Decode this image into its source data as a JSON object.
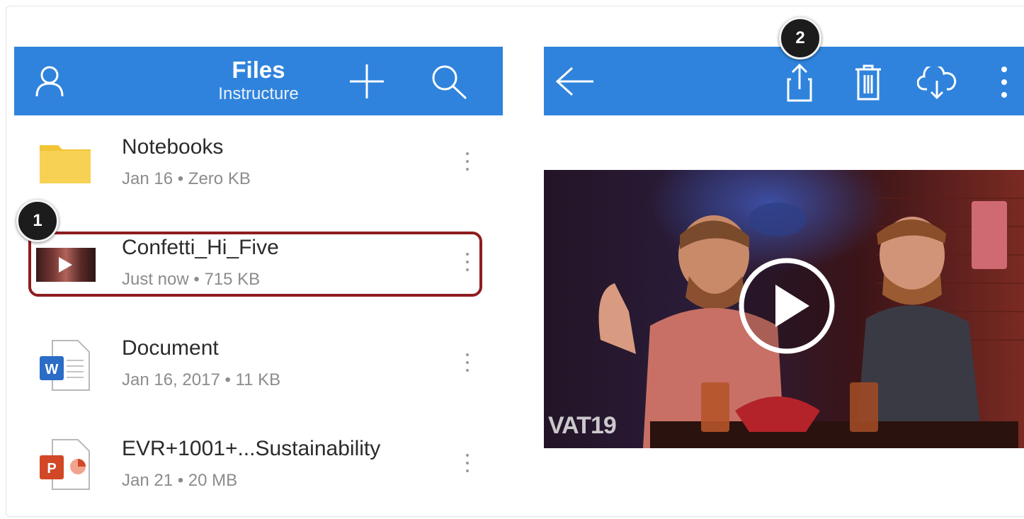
{
  "header": {
    "title": "Files",
    "subtitle": "Instructure"
  },
  "files": [
    {
      "name": "Notebooks",
      "meta": "Jan 16 • Zero KB",
      "icon": "folder-icon"
    },
    {
      "name": "Confetti_Hi_Five",
      "meta": "Just now • 715 KB",
      "icon": "video-thumbnail"
    },
    {
      "name": "Document",
      "meta": "Jan 16, 2017 • 11 KB",
      "icon": "word-document-icon"
    },
    {
      "name": "EVR+1001+...Sustainability",
      "meta": "Jan 21 • 20 MB",
      "icon": "powerpoint-icon"
    }
  ],
  "callouts": {
    "first": "1",
    "second": "2"
  },
  "icons": {
    "left_bar": [
      "profile-icon",
      "add-icon",
      "search-icon"
    ],
    "right_bar": [
      "back-arrow-icon",
      "share-icon",
      "delete-icon",
      "download-icon",
      "more-options-icon"
    ]
  },
  "colors": {
    "toolbar": "#2f83dc",
    "highlight": "#8e1c1f",
    "folder": "#f7d154",
    "word": "#2b6cc7",
    "powerpoint": "#d24726"
  },
  "video_watermark": "VAT19"
}
